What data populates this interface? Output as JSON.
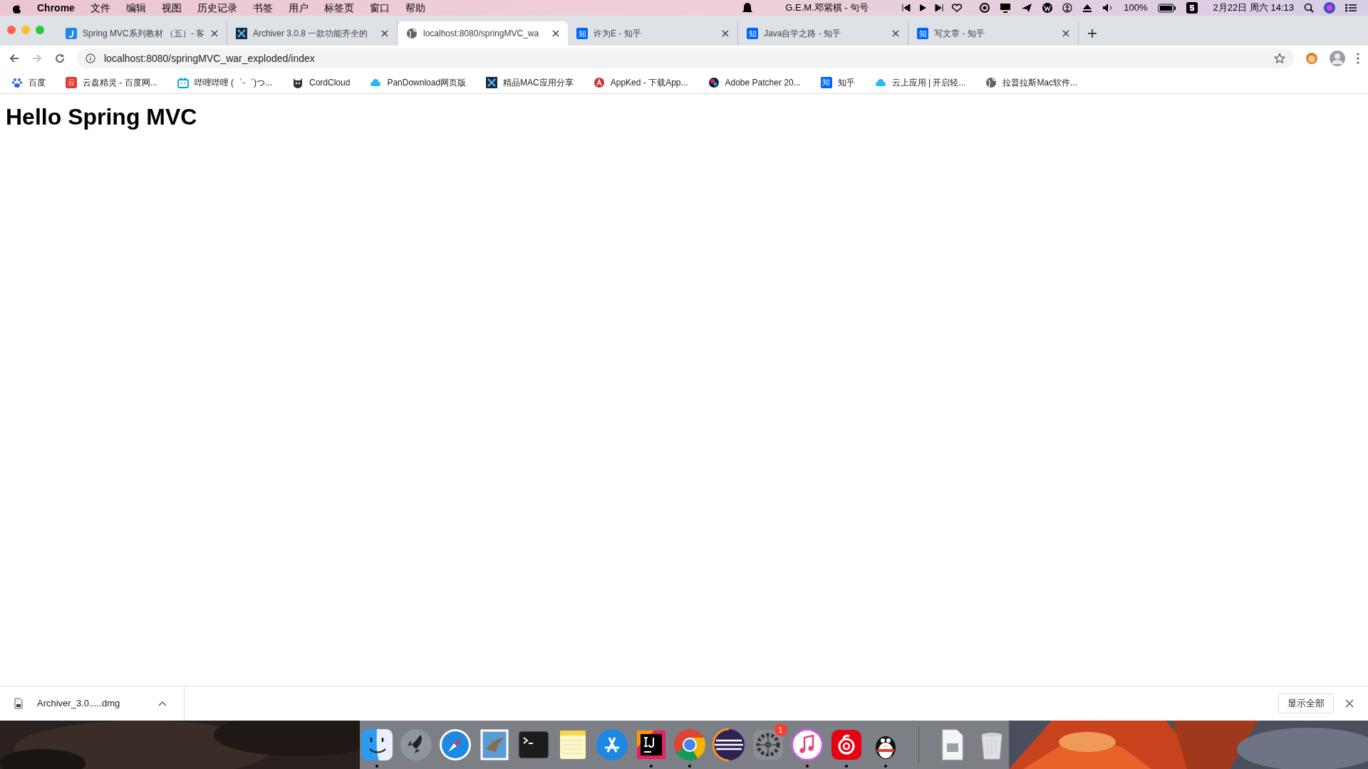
{
  "menu_bar": {
    "app": "Chrome",
    "menus": [
      "文件",
      "编辑",
      "视图",
      "历史记录",
      "书签",
      "用户",
      "标签页",
      "窗口",
      "帮助"
    ],
    "now_playing": "G.E.M.邓紫棋 - 句号",
    "battery": "100%",
    "clock": "2月22日 周六 14:13"
  },
  "tabs": [
    {
      "title": "Spring MVC系列教材 （五）- 客",
      "kind": "j",
      "selected": false
    },
    {
      "title": "Archiver 3.0.8 一款功能齐全的",
      "kind": "x",
      "selected": false
    },
    {
      "title": "localhost:8080/springMVC_wa",
      "kind": "globe",
      "selected": true
    },
    {
      "title": "许为E - 知乎",
      "kind": "zhihu",
      "icon_text": "知",
      "selected": false
    },
    {
      "title": "Java自学之路 - 知乎",
      "kind": "zhihu",
      "icon_text": "知",
      "selected": false
    },
    {
      "title": "写文章 - 知乎",
      "kind": "zhihu",
      "icon_text": "知",
      "selected": false
    }
  ],
  "address_bar": {
    "url": "localhost:8080/springMVC_war_exploded/index"
  },
  "bookmarks": [
    {
      "label": "百度",
      "kind": "paw"
    },
    {
      "label": "云盘精灵 - 百度网...",
      "kind": "cloudred",
      "icon_text": "云"
    },
    {
      "label": "哔哩哔哩 (゜-゜)つ...",
      "kind": "tv"
    },
    {
      "label": "CordCloud",
      "kind": "cat"
    },
    {
      "label": "PanDownload网页版",
      "kind": "cloud"
    },
    {
      "label": "精品MAC应用分享",
      "kind": "x"
    },
    {
      "label": "AppKed - 下载App...",
      "kind": "red"
    },
    {
      "label": "Adobe Patcher 20...",
      "kind": "ball"
    },
    {
      "label": "知乎",
      "kind": "zhihu",
      "icon_text": "知"
    },
    {
      "label": "云上应用 | 开启轻...",
      "kind": "cloud"
    },
    {
      "label": "拉普拉斯Mac软件...",
      "kind": "globe"
    }
  ],
  "page": {
    "heading": "Hello Spring MVC"
  },
  "download_bar": {
    "file": "Archiver_3.0.....dmg",
    "show_all": "显示全部"
  },
  "dock": [
    {
      "kind": "finder",
      "running": true
    },
    {
      "kind": "launchpad",
      "running": false
    },
    {
      "kind": "safari",
      "running": false
    },
    {
      "kind": "mail",
      "running": false
    },
    {
      "kind": "terminal",
      "running": false
    },
    {
      "kind": "notes",
      "running": false
    },
    {
      "kind": "appstore",
      "running": false
    },
    {
      "kind": "intellij",
      "running": true
    },
    {
      "kind": "chrome",
      "running": true
    },
    {
      "kind": "eclipse",
      "running": false
    },
    {
      "kind": "settings",
      "running": false,
      "badge": "1"
    },
    {
      "kind": "music",
      "running": true
    },
    {
      "kind": "netease",
      "running": true
    },
    {
      "kind": "qq",
      "running": true
    },
    {
      "kind": "separator"
    },
    {
      "kind": "file",
      "running": false
    },
    {
      "kind": "trash",
      "running": false
    }
  ]
}
